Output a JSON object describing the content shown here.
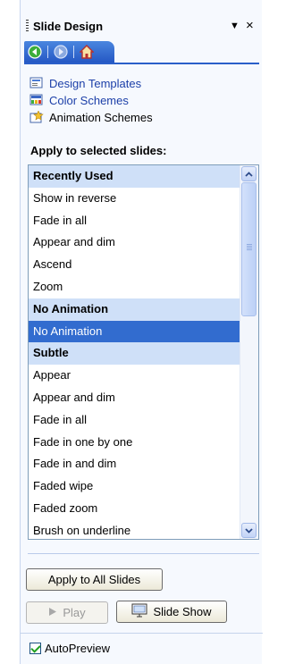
{
  "pane": {
    "title": "Slide Design",
    "dropdown_icon": "triangle-down-icon",
    "close_glyph": "×"
  },
  "nav": {
    "buttons": [
      "back-icon",
      "forward-icon",
      "home-icon"
    ]
  },
  "links": [
    {
      "label": "Design Templates",
      "icon": "design-templates-icon",
      "state": "link"
    },
    {
      "label": "Color Schemes",
      "icon": "color-schemes-icon",
      "state": "link"
    },
    {
      "label": "Animation Schemes",
      "icon": "animation-schemes-icon",
      "state": "current"
    }
  ],
  "apply_heading": "Apply to selected slides:",
  "animation_list": {
    "rows": [
      {
        "text": "Recently Used",
        "kind": "group"
      },
      {
        "text": "Show in reverse",
        "kind": "item"
      },
      {
        "text": "Fade in all",
        "kind": "item"
      },
      {
        "text": "Appear and dim",
        "kind": "item"
      },
      {
        "text": "Ascend",
        "kind": "item"
      },
      {
        "text": "Zoom",
        "kind": "item"
      },
      {
        "text": "No Animation",
        "kind": "group"
      },
      {
        "text": "No Animation",
        "kind": "selected"
      },
      {
        "text": "Subtle",
        "kind": "group"
      },
      {
        "text": "Appear",
        "kind": "item"
      },
      {
        "text": "Appear and dim",
        "kind": "item"
      },
      {
        "text": "Fade in all",
        "kind": "item"
      },
      {
        "text": "Fade in one by one",
        "kind": "item"
      },
      {
        "text": "Fade in and dim",
        "kind": "item"
      },
      {
        "text": "Faded wipe",
        "kind": "item"
      },
      {
        "text": "Faded zoom",
        "kind": "item"
      },
      {
        "text": "Brush on underline",
        "kind": "item"
      }
    ]
  },
  "buttons": {
    "apply_all": "Apply to All Slides",
    "play": "Play",
    "slide_show": "Slide Show"
  },
  "autopreview": {
    "label": "AutoPreview",
    "checked": true
  },
  "colors": {
    "accent": "#2558c4",
    "selection": "#326ccf",
    "group_header": "#cfe0f8",
    "link": "#1c3fa8"
  }
}
